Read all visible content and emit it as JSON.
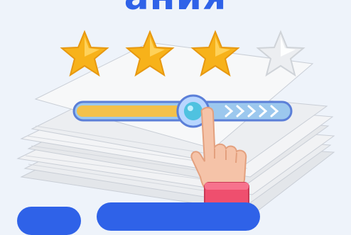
{
  "headline": {
    "text": "ания"
  },
  "rating": {
    "value": 3,
    "max": 5
  },
  "slider": {
    "value": 0.55
  },
  "colors": {
    "background": "#eef3fa",
    "headline": "#2f62e8",
    "star_filled": "#f7b21a",
    "star_empty": "#e8ebef",
    "track_fill": "#f3c14a",
    "track_bg": "#9cc8ee",
    "thumb": "#4fc2e0",
    "hand_skin": "#f5c3a8",
    "sleeve": "#ef4f6e"
  },
  "icons": {
    "star": "star-icon",
    "chevron": "chevron-right-icon",
    "hand": "pointing-hand-icon"
  }
}
